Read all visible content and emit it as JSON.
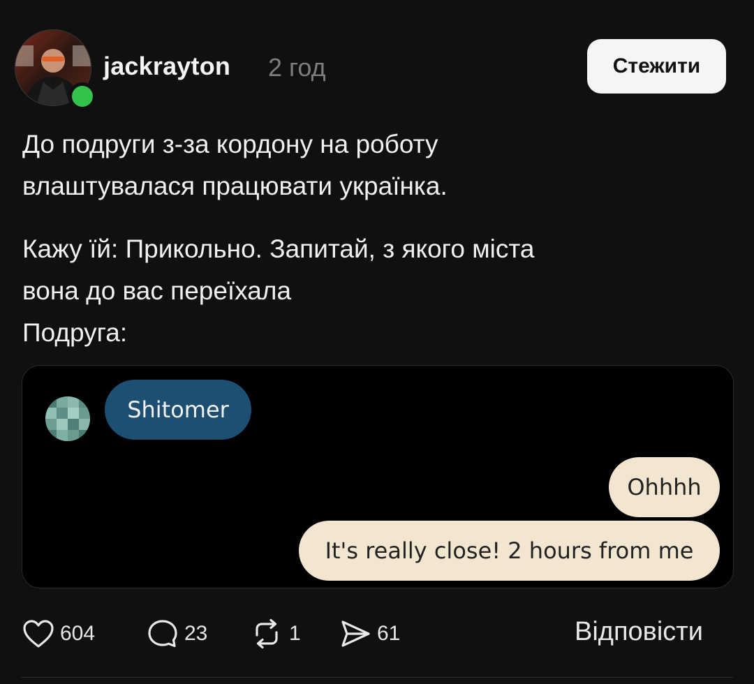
{
  "post": {
    "username": "jackrayton",
    "timestamp": "2 год",
    "follow_label": "Стежити",
    "paragraphs": [
      "До подруги з-за кордону на роботу\nвлаштувалася працювати українка.",
      "Кажу їй: Прикольно. Запитай, з якого міста\nвона до вас переїхала",
      "Подруга:"
    ]
  },
  "media": {
    "incoming_message": "Shitomer",
    "outgoing_messages": [
      "Ohhhh",
      "It's really close! 2 hours from me"
    ]
  },
  "actions": {
    "likes": "604",
    "comments": "23",
    "reposts": "1",
    "shares": "61",
    "reply_label": "Відповісти"
  },
  "colors": {
    "background": "#101010",
    "online": "#35c24a",
    "incoming_bubble": "#1d4f73",
    "outgoing_bubble": "#f2e6d0"
  }
}
